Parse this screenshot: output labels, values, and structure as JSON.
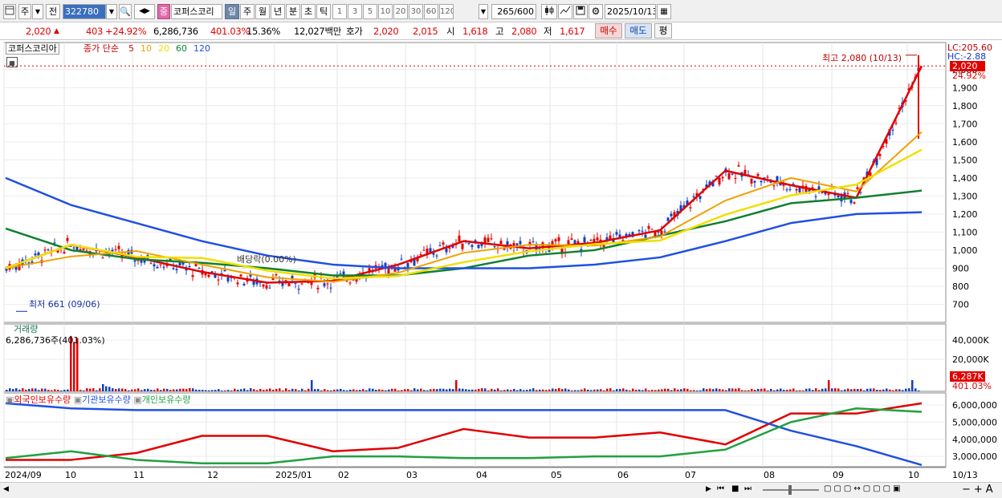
{
  "toolbar": {
    "chart_icon": "chart-icon",
    "market": "주",
    "market_sub": "전",
    "code": "322780",
    "stock_badge": "중",
    "stock_name": "코퍼스코리",
    "periods": [
      "일",
      "주",
      "월",
      "년",
      "분",
      "초",
      "틱"
    ],
    "active_period": "일",
    "intervals": [
      "1",
      "3",
      "5",
      "10",
      "20",
      "30",
      "60",
      "120"
    ],
    "count": "265",
    "count_total": "/600",
    "date": "2025/10/13"
  },
  "quote": {
    "price": "2,020",
    "change": "403",
    "change_pct": "+24.92%",
    "volume": "6,286,736",
    "volume_ratio": "401.03%",
    "turnover": "15.36%",
    "amount": "12,027백만",
    "hoga_label": "호가",
    "ask": "2,020",
    "bid": "2,015",
    "open_label": "시",
    "open": "1,618",
    "high_label": "고",
    "high": "2,080",
    "low_label": "저",
    "low": "1,617",
    "buy_label": "매수",
    "sell_label": "매도",
    "eval_label": "평"
  },
  "legend": {
    "stock": "코퍼스코리아",
    "ma_title": "종가 단순",
    "ma": [
      {
        "period": "5",
        "color": "#e00000"
      },
      {
        "period": "10",
        "color": "#f0a000"
      },
      {
        "period": "20",
        "color": "#f0e000"
      },
      {
        "period": "60",
        "color": "#108030"
      },
      {
        "period": "120",
        "color": "#2050e0"
      }
    ]
  },
  "price_panel": {
    "lc": "LC:205.60",
    "hc": "HC:-2.88",
    "price_tag": "2,020",
    "pct_tag": "24.92%",
    "high_note": "최고 2,080 (10/13)",
    "low_note": "최저 661 (09/06)",
    "overlay_note": "배당락(0.00%)"
  },
  "volume_panel": {
    "title": "거래량",
    "value": "6,286,736주(401.03%)",
    "tag": "6,287K",
    "tag_pct": "401.03%"
  },
  "holder_panel": {
    "series": [
      "외국인보유수량",
      "기관보유수량",
      "개인보유수량"
    ],
    "colors": [
      "#e00000",
      "#2050e0",
      "#20a040"
    ]
  },
  "x_axis": {
    "labels": [
      "2024/09",
      "10",
      "11",
      "12",
      "2025/01",
      "02",
      "03",
      "04",
      "05",
      "06",
      "07",
      "08",
      "09",
      "10"
    ],
    "last_date": "10/13"
  },
  "chart_data": [
    {
      "type": "line",
      "title": "코퍼스코리아",
      "ylim": [
        661,
        2080
      ],
      "y_ticks": [
        "2,000",
        "1,900",
        "1,800",
        "1,700",
        "1,600",
        "1,500",
        "1,400",
        "1,300",
        "1,200",
        "1,100",
        "1,000",
        "900",
        "800",
        "700"
      ],
      "x": [
        "2024/09",
        "10",
        "11",
        "12",
        "2025/01",
        "02",
        "03",
        "04",
        "05",
        "06",
        "07",
        "08",
        "09",
        "10"
      ],
      "series": [
        {
          "name": "5",
          "values": [
            900,
            1030,
            960,
            880,
            820,
            830,
            920,
            1050,
            1010,
            1040,
            1110,
            1440,
            1360,
            1290,
            2020
          ]
        },
        {
          "name": "60",
          "values": [
            1120,
            1000,
            950,
            930,
            900,
            860,
            860,
            900,
            970,
            1000,
            1080,
            1160,
            1260,
            1290,
            1330
          ]
        },
        {
          "name": "120",
          "values": [
            1400,
            1250,
            1150,
            1050,
            970,
            920,
            900,
            900,
            900,
            920,
            960,
            1050,
            1150,
            1200,
            1210
          ]
        }
      ],
      "closing": {
        "last": 2020,
        "high": 2080,
        "low": 661
      }
    },
    {
      "type": "bar",
      "title": "거래량",
      "y_ticks": [
        "40,000K",
        "20,000K"
      ],
      "last_value": 6286736
    },
    {
      "type": "line",
      "title": "외국인보유수량 / 기관보유수량 / 개인보유수량",
      "y_ticks": [
        "6,000,000",
        "5,000,000",
        "4,000,000",
        "3,000,000"
      ],
      "series": [
        {
          "name": "외국인보유수량",
          "values": [
            2800000,
            2800000,
            3200000,
            4200000,
            4200000,
            3300000,
            3500000,
            4600000,
            4100000,
            4100000,
            4400000,
            3700000,
            5500000,
            5500000,
            6100000
          ]
        },
        {
          "name": "기관보유수량",
          "values": [
            6100000,
            5800000,
            5700000,
            5700000,
            5700000,
            5700000,
            5700000,
            5700000,
            5700000,
            5700000,
            5700000,
            5700000,
            4500000,
            3600000,
            2500000
          ]
        },
        {
          "name": "개인보유수량",
          "values": [
            2900000,
            3300000,
            2800000,
            2600000,
            2600000,
            3000000,
            3000000,
            2900000,
            2900000,
            3000000,
            3000000,
            3400000,
            5000000,
            5800000,
            5600000
          ]
        }
      ]
    }
  ]
}
